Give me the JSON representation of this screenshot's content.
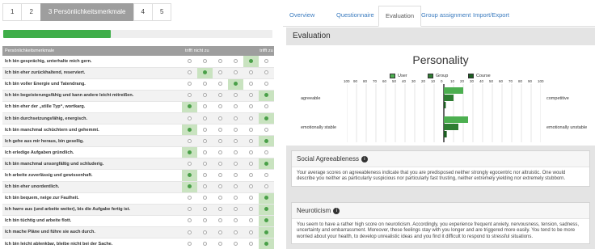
{
  "pager": {
    "items": [
      "1",
      "2",
      "3 Persönlichkeitsmerkmale",
      "4",
      "5"
    ],
    "active": 2
  },
  "progress": {
    "fraction": 0.4
  },
  "questionnaire": {
    "header": {
      "col": "Persönlichkeitsmerkmale",
      "left": "trifft nicht zu",
      "right": "trifft zu"
    },
    "rows": [
      {
        "text": "Ich bin gesprächig, unterhalte mich gern.",
        "sel": 4
      },
      {
        "text": "Ich bin eher zurückhaltend, reserviert.",
        "sel": 1
      },
      {
        "text": "Ich bin voller Energie und Tatendrang.",
        "sel": 3
      },
      {
        "text": "Ich bin begeisterungsfähig und kann andere leicht mitreißen.",
        "sel": 5
      },
      {
        "text": "Ich bin eher der „stille Typ“, wortkarg.",
        "sel": 0
      },
      {
        "text": "Ich bin durchsetzungsfähig, energisch.",
        "sel": 5
      },
      {
        "text": "Ich bin manchmal schüchtern und gehemmt.",
        "sel": 0
      },
      {
        "text": "Ich gehe aus mir heraus, bin gesellig.",
        "sel": 5
      },
      {
        "text": "Ich erledige Aufgaben gründlich.",
        "sel": 0
      },
      {
        "text": "Ich bin manchmal unsorgfältig und schluderig.",
        "sel": 5
      },
      {
        "text": "Ich arbeite zuverlässig und gewissenhaft.",
        "sel": 0
      },
      {
        "text": "Ich bin eher unordentlich.",
        "sel": 0
      },
      {
        "text": "Ich bin bequem, neige zur Faulheit.",
        "sel": 5
      },
      {
        "text": "Ich harre aus (und arbeite weiter), bis die Aufgabe fertig ist.",
        "sel": 5
      },
      {
        "text": "Ich bin tüchtig und arbeite flott.",
        "sel": 5
      },
      {
        "text": "Ich mache Pläne und führe sie auch durch.",
        "sel": 5
      },
      {
        "text": "Ich bin leicht ablenkbar, bleibe nicht bei der Sache.",
        "sel": 5
      }
    ]
  },
  "tabs": [
    "Overview",
    "Questionnaire",
    "Evaluation",
    "Group assignment",
    "Import/Export"
  ],
  "active_tab": 2,
  "evaluation": {
    "title": "Evaluation"
  },
  "chart_data": {
    "type": "bar",
    "title": "Personality",
    "orientation": "horizontal",
    "xlim": [
      -100,
      100
    ],
    "x_ticks": [
      "100",
      "90",
      "80",
      "70",
      "60",
      "50",
      "40",
      "30",
      "20",
      "10",
      "0",
      "10",
      "20",
      "30",
      "40",
      "50",
      "60",
      "70",
      "80",
      "90",
      "100"
    ],
    "categories": [
      {
        "left": "agreeable",
        "right": "competitive"
      },
      {
        "left": "emotionally stable",
        "right": "emotionally unstable"
      }
    ],
    "series": [
      {
        "name": "User",
        "color": "#4caf50",
        "values": [
          20,
          25
        ]
      },
      {
        "name": "Group",
        "color": "#2e7d32",
        "values": [
          10,
          15
        ]
      },
      {
        "name": "Course",
        "color": "#1b5e20",
        "values": [
          2,
          3
        ]
      }
    ],
    "legend_position": "top"
  },
  "cards": [
    {
      "title": "Social Agreeableness",
      "text": "Your average scores on agreeableness indicate that you are predisposed neither strongly egocentric nor altruistic. One would describe you neither as particularly suspicious nor particularly fast trusting, neither extremely yielding nor extremely stubborn."
    },
    {
      "title": "Neuroticism",
      "text": "You seem to have a rather high score on neuroticism. Accordingly, you experience frequent anxiety, nervousness, tension, sadness, uncertainty and embarrassment. Moreover, these feelings stay with you longer and are triggered more easily. You tend to be more worried about your health, to develop unrealistic ideas and you find it difficult to respond to stressful situations."
    }
  ]
}
